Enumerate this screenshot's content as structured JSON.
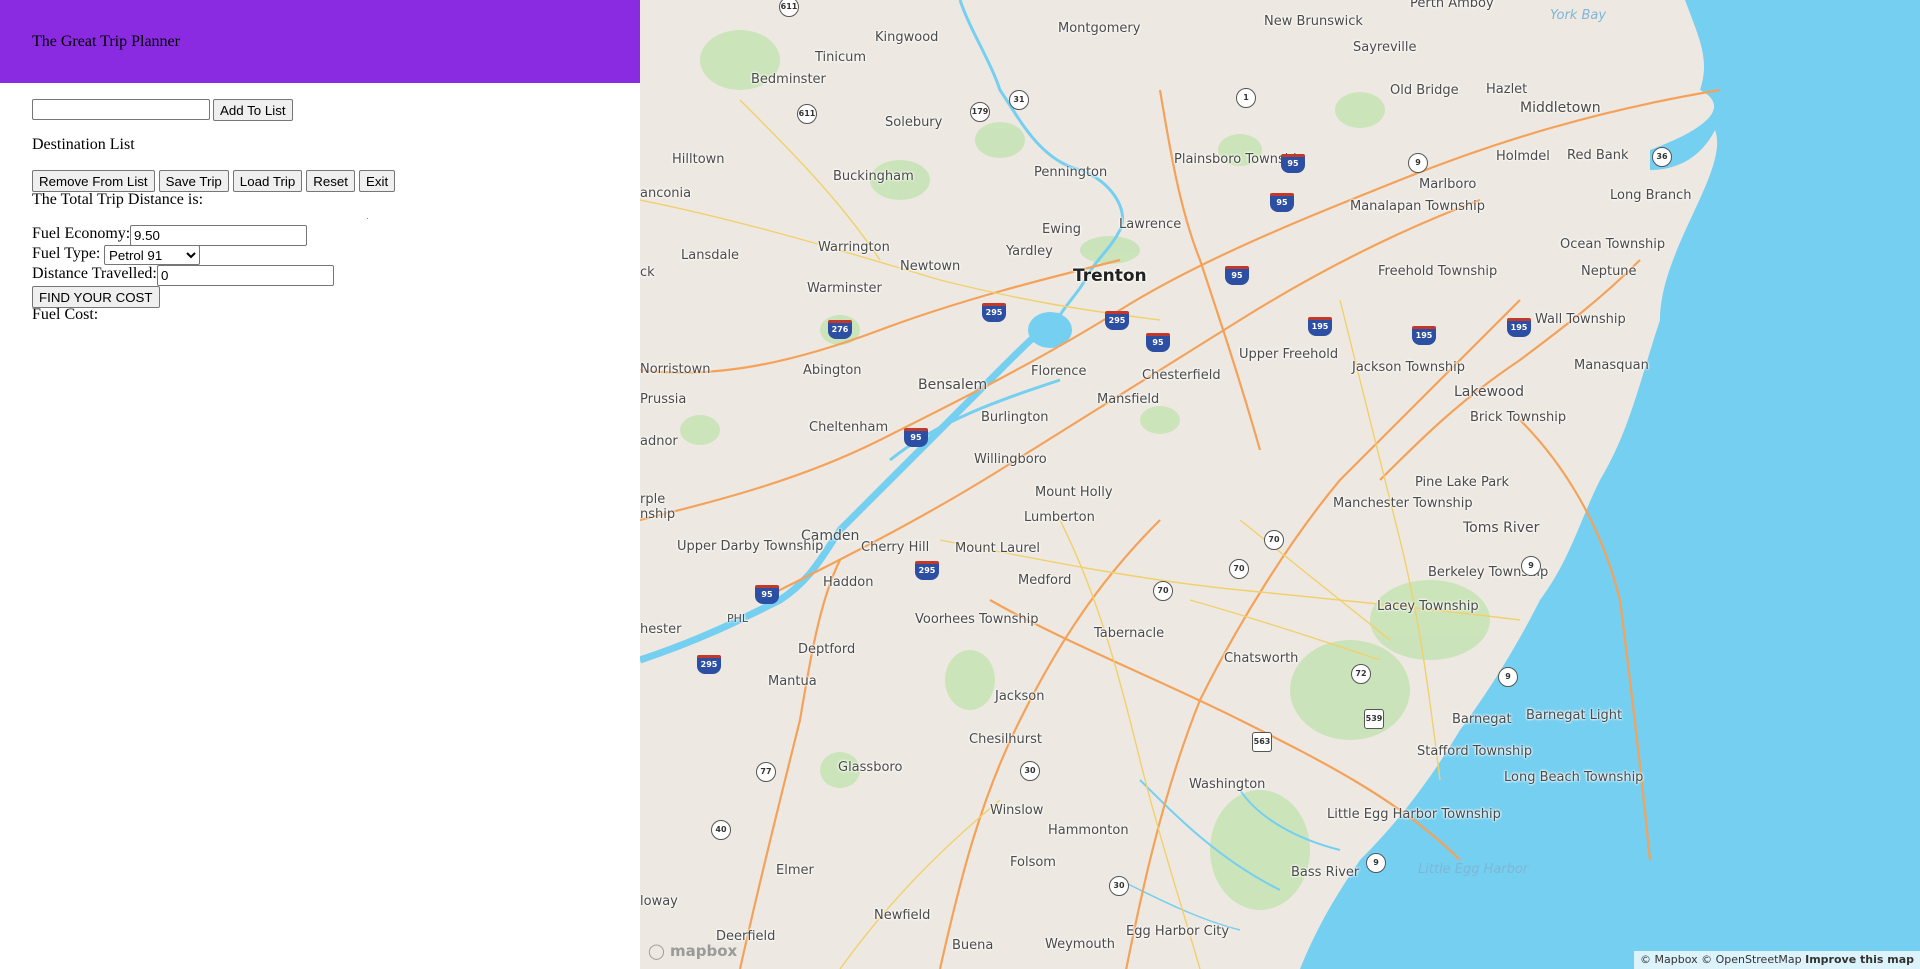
{
  "app": {
    "title": "The Great Trip Planner",
    "header_color": "#8a2be2"
  },
  "planner": {
    "destination_input": {
      "value": "",
      "placeholder": ""
    },
    "add_button": "Add To List",
    "destination_list_title": "Destination List",
    "buttons": [
      "Remove From List",
      "Save Trip",
      "Load Trip",
      "Reset",
      "Exit"
    ],
    "total_distance_label": "The Total Trip Distance is:",
    "fuel_economy_label": "Fuel Economy:",
    "fuel_economy_value": "9.50",
    "fuel_type_label": "Fuel Type:",
    "fuel_type_selected": "Petrol 91",
    "distance_label": "Distance Travelled:",
    "distance_value": "0",
    "find_button": "FIND YOUR COST",
    "fuel_cost_label": "Fuel Cost:"
  },
  "map": {
    "water_color": "#75cff0",
    "land_color": "#ede9e2",
    "park_color": "#c8e3b6",
    "places": [
      {
        "name": "Kingwood",
        "big": false
      },
      {
        "name": "Montgomery",
        "big": false
      },
      {
        "name": "New Brunswick",
        "big": false
      },
      {
        "name": "Perth Amboy",
        "big": false
      },
      {
        "name": "York Bay",
        "big": false
      },
      {
        "name": "Tinicum",
        "big": false
      },
      {
        "name": "Sayreville",
        "big": false
      },
      {
        "name": "Bedminster",
        "big": false
      },
      {
        "name": "Old Bridge",
        "big": false
      },
      {
        "name": "Hazlet",
        "big": false
      },
      {
        "name": "Solebury",
        "big": false
      },
      {
        "name": "Middletown",
        "big": false
      },
      {
        "name": "Hilltown",
        "big": false
      },
      {
        "name": "Holmdel",
        "big": false
      },
      {
        "name": "Red Bank",
        "big": false
      },
      {
        "name": "Buckingham",
        "big": false
      },
      {
        "name": "Pennington",
        "big": false
      },
      {
        "name": "Plainsboro Township",
        "big": false
      },
      {
        "name": "Marlboro",
        "big": false
      },
      {
        "name": "Long Branch",
        "big": false
      },
      {
        "name": "anconia",
        "big": false
      },
      {
        "name": "Manalapan Township",
        "big": false
      },
      {
        "name": "Ewing",
        "big": false
      },
      {
        "name": "Lawrence",
        "big": false
      },
      {
        "name": "Ocean Township",
        "big": false
      },
      {
        "name": "Warrington",
        "big": false
      },
      {
        "name": "Yardley",
        "big": false
      },
      {
        "name": "Lansdale",
        "big": false
      },
      {
        "name": "Newtown",
        "big": false
      },
      {
        "name": "Trenton",
        "big": true
      },
      {
        "name": "Freehold Township",
        "big": false
      },
      {
        "name": "Neptune",
        "big": false
      },
      {
        "name": "Warminster",
        "big": false
      },
      {
        "name": "Wall Township",
        "big": false
      },
      {
        "name": "Upper Freehold",
        "big": false
      },
      {
        "name": "Abington",
        "big": false
      },
      {
        "name": "Florence",
        "big": false
      },
      {
        "name": "Manasquan",
        "big": false
      },
      {
        "name": "Norristown",
        "big": false
      },
      {
        "name": "Jackson Township",
        "big": false
      },
      {
        "name": "Chesterfield",
        "big": false
      },
      {
        "name": "Bensalem",
        "big": false
      },
      {
        "name": "Lakewood",
        "big": false
      },
      {
        "name": "Prussia",
        "big": false
      },
      {
        "name": "Mansfield",
        "big": false
      },
      {
        "name": "Brick Township",
        "big": false
      },
      {
        "name": "Cheltenham",
        "big": false
      },
      {
        "name": "Burlington",
        "big": false
      },
      {
        "name": "adnor",
        "big": false
      },
      {
        "name": "Willingboro",
        "big": false
      },
      {
        "name": "Pine Lake Park",
        "big": false
      },
      {
        "name": "Mount Holly",
        "big": false
      },
      {
        "name": "rple nship",
        "big": false
      },
      {
        "name": "Manchester Township",
        "big": false
      },
      {
        "name": "Lumberton",
        "big": false
      },
      {
        "name": "Toms River",
        "big": false
      },
      {
        "name": "Camden",
        "big": true
      },
      {
        "name": "Upper Darby Township",
        "big": false
      },
      {
        "name": "Cherry Hill",
        "big": false
      },
      {
        "name": "Mount Laurel",
        "big": false
      },
      {
        "name": "Berkeley Township",
        "big": false
      },
      {
        "name": "Haddon",
        "big": false
      },
      {
        "name": "Medford",
        "big": false
      },
      {
        "name": "Lacey Township",
        "big": false
      },
      {
        "name": "PHL",
        "big": false
      },
      {
        "name": "Voorhees Township",
        "big": false
      },
      {
        "name": "hester",
        "big": false
      },
      {
        "name": "Tabernacle",
        "big": false
      },
      {
        "name": "Deptford",
        "big": false
      },
      {
        "name": "Chatsworth",
        "big": false
      },
      {
        "name": "Mantua",
        "big": false
      },
      {
        "name": "Jackson",
        "big": false
      },
      {
        "name": "Barnegat",
        "big": false
      },
      {
        "name": "Barnegat Light",
        "big": false
      },
      {
        "name": "Chesilhurst",
        "big": false
      },
      {
        "name": "Stafford Township",
        "big": false
      },
      {
        "name": "Glassboro",
        "big": false
      },
      {
        "name": "Washington",
        "big": false
      },
      {
        "name": "Long Beach Township",
        "big": false
      },
      {
        "name": "Winslow",
        "big": false
      },
      {
        "name": "Little Egg Harbor Township",
        "big": false
      },
      {
        "name": "Hammonton",
        "big": false
      },
      {
        "name": "Folsom",
        "big": false
      },
      {
        "name": "Elmer",
        "big": false
      },
      {
        "name": "Bass River",
        "big": false
      },
      {
        "name": "Little Egg Harbor",
        "big": false
      },
      {
        "name": "loway",
        "big": false
      },
      {
        "name": "Newfield",
        "big": false
      },
      {
        "name": "Egg Harbor City",
        "big": false
      },
      {
        "name": "Deerfield",
        "big": false
      },
      {
        "name": "Buena",
        "big": false
      },
      {
        "name": "Weymouth",
        "big": false
      },
      {
        "name": "ck",
        "big": false
      }
    ],
    "shields": [
      "611",
      "611",
      "179",
      "31",
      "1",
      "9",
      "36",
      "95",
      "95",
      "95",
      "276",
      "295",
      "295",
      "195",
      "195",
      "195",
      "95",
      "95",
      "295",
      "95",
      "295",
      "70",
      "70",
      "70",
      "9",
      "72",
      "539",
      "563",
      "9",
      "30",
      "77",
      "40",
      "30",
      "9",
      "30"
    ],
    "logo": "mapbox",
    "attribution": {
      "mapbox": "© Mapbox",
      "osm": "© OpenStreetMap",
      "improve": "Improve this map"
    }
  }
}
